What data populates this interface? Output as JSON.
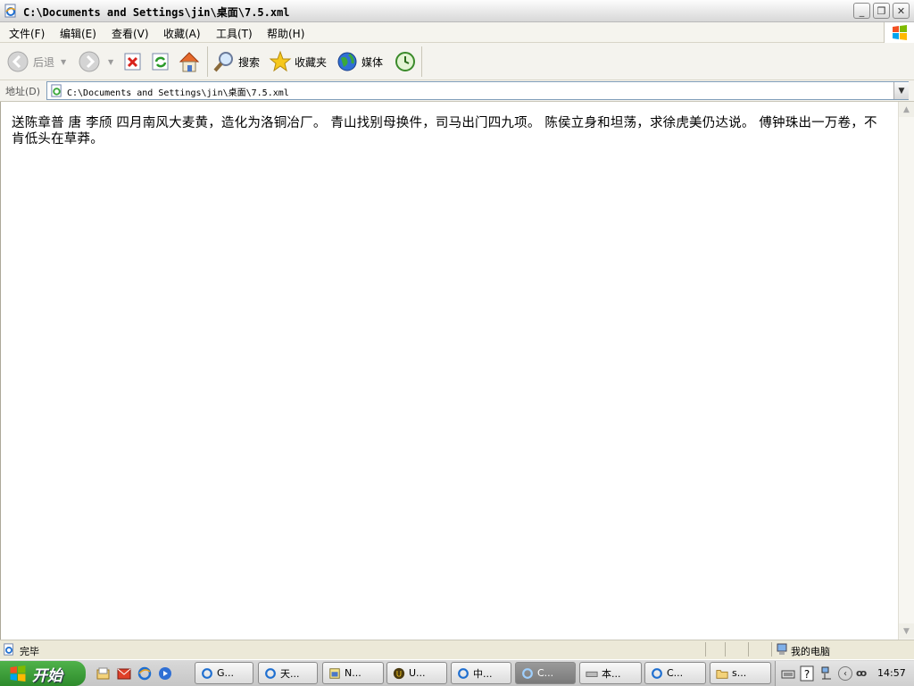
{
  "window": {
    "title": "C:\\Documents and Settings\\jin\\桌面\\7.5.xml",
    "minimize_glyph": "_",
    "restore_glyph": "❐",
    "close_glyph": "✕"
  },
  "menu": [
    "文件(F)",
    "编辑(E)",
    "查看(V)",
    "收藏(A)",
    "工具(T)",
    "帮助(H)"
  ],
  "toolbar": {
    "back_label": "后退",
    "search_label": "搜索",
    "favorites_label": "收藏夹",
    "media_label": "媒体"
  },
  "address": {
    "label": "地址(D)",
    "value": "C:\\Documents and Settings\\jin\\桌面\\7.5.xml"
  },
  "content": {
    "text": "送陈章普 唐 李颀 四月南风大麦黄，造化为洛铜冶厂。 青山找别母换件，司马出门四九项。 陈侯立身和坦荡，求徐虎美仍达说。 傅钟珠出一万卷，不肯低头在草莽。"
  },
  "status": {
    "text": "完毕",
    "zone": "我的电脑"
  },
  "taskbar": {
    "start_label": "开始",
    "tasks": [
      {
        "label": "G..."
      },
      {
        "label": "天..."
      },
      {
        "label": "N..."
      },
      {
        "label": "U..."
      },
      {
        "label": "中..."
      },
      {
        "label": "C...",
        "active": true
      },
      {
        "label": "本..."
      },
      {
        "label": "C..."
      },
      {
        "label": "s..."
      }
    ],
    "clock": "14:57"
  }
}
